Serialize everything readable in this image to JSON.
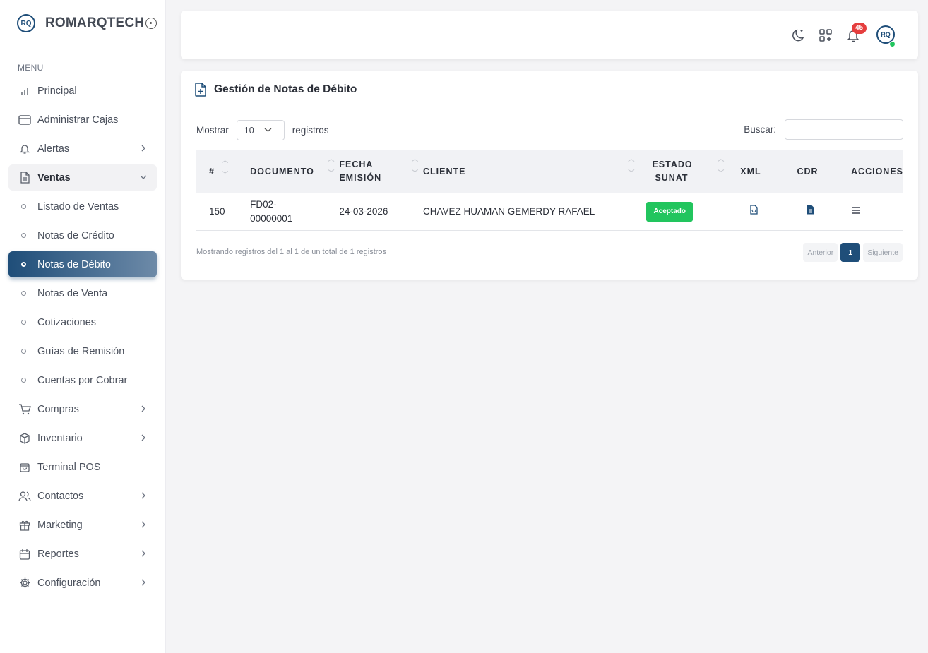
{
  "brand": {
    "logo_text": "RQ",
    "name": "ROMARQTECH"
  },
  "menu_label": "MENU",
  "sidebar": {
    "items": [
      {
        "label": "Principal"
      },
      {
        "label": "Administrar Cajas"
      },
      {
        "label": "Alertas"
      },
      {
        "label": "Ventas"
      },
      {
        "label": "Compras"
      },
      {
        "label": "Inventario"
      },
      {
        "label": "Terminal POS"
      },
      {
        "label": "Contactos"
      },
      {
        "label": "Marketing"
      },
      {
        "label": "Reportes"
      },
      {
        "label": "Configuración"
      }
    ],
    "ventas_sub": [
      {
        "label": "Listado de Ventas"
      },
      {
        "label": "Notas de Crédito"
      },
      {
        "label": "Notas de Débito"
      },
      {
        "label": "Notas de Venta"
      },
      {
        "label": "Cotizaciones"
      },
      {
        "label": "Guías de Remisión"
      },
      {
        "label": "Cuentas por Cobrar"
      }
    ]
  },
  "header": {
    "notification_count": "45",
    "avatar_text": "RQ"
  },
  "page": {
    "title": "Gestión de Notas de Débito"
  },
  "table_controls": {
    "show_label": "Mostrar",
    "page_size": "10",
    "records_label": "registros",
    "search_label": "Buscar:",
    "search_value": ""
  },
  "table": {
    "columns": [
      "#",
      "DOCUMENTO",
      "FECHA EMISIÓN",
      "CLIENTE",
      "ESTADO SUNAT",
      "XML",
      "CDR",
      "ACCIONES"
    ],
    "col_lines": {
      "fecha_1": "FECHA",
      "fecha_2": "EMISIÓN",
      "estado_1": "ESTADO",
      "estado_2": "SUNAT"
    },
    "rows": [
      {
        "num": "150",
        "doc_1": "FD02-",
        "doc_2": "00000001",
        "fecha": "24-03-2026",
        "cliente": "CHAVEZ HUAMAN GEMERDY RAFAEL",
        "estado": "Aceptado"
      }
    ]
  },
  "footer": {
    "info": "Mostrando registros del 1 al 1 de un total de 1 registros",
    "prev": "Anterior",
    "current": "1",
    "next": "Siguiente"
  },
  "colors": {
    "primary": "#1f4e79",
    "success": "#22c55e",
    "danger": "#e53e3e"
  }
}
